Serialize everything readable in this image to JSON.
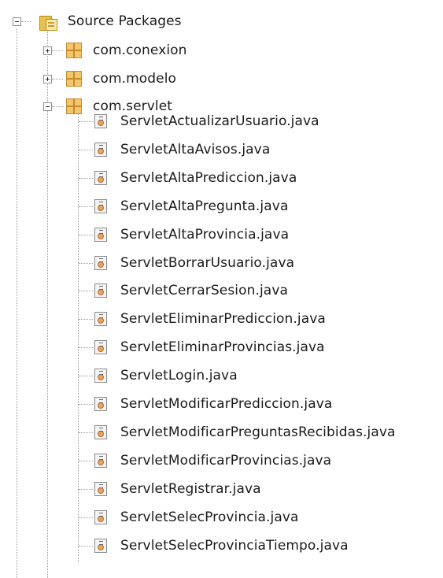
{
  "tree": {
    "root": {
      "label": "Source Packages",
      "icon": "source-packages-icon",
      "expanded": true
    },
    "packages": [
      {
        "label": "com.conexion",
        "icon": "package-icon",
        "expanded": false
      },
      {
        "label": "com.modelo",
        "icon": "package-icon",
        "expanded": false
      },
      {
        "label": "com.servlet",
        "icon": "package-icon",
        "expanded": true
      }
    ],
    "files": [
      "ServletActualizarUsuario.java",
      "ServletAltaAvisos.java",
      "ServletAltaPrediccion.java",
      "ServletAltaPregunta.java",
      "ServletAltaProvincia.java",
      "ServletBorrarUsuario.java",
      "ServletCerrarSesion.java",
      "ServletEliminarPrediccion.java",
      "ServletEliminarProvincias.java",
      "ServletLogin.java",
      "ServletModificarPrediccion.java",
      "ServletModificarPreguntasRecibidas.java",
      "ServletModificarProvincias.java",
      "ServletRegistrar.java",
      "ServletSelecProvincia.java",
      "ServletSelecProvinciaTiempo.java"
    ],
    "file_icon": "java-file-icon"
  }
}
